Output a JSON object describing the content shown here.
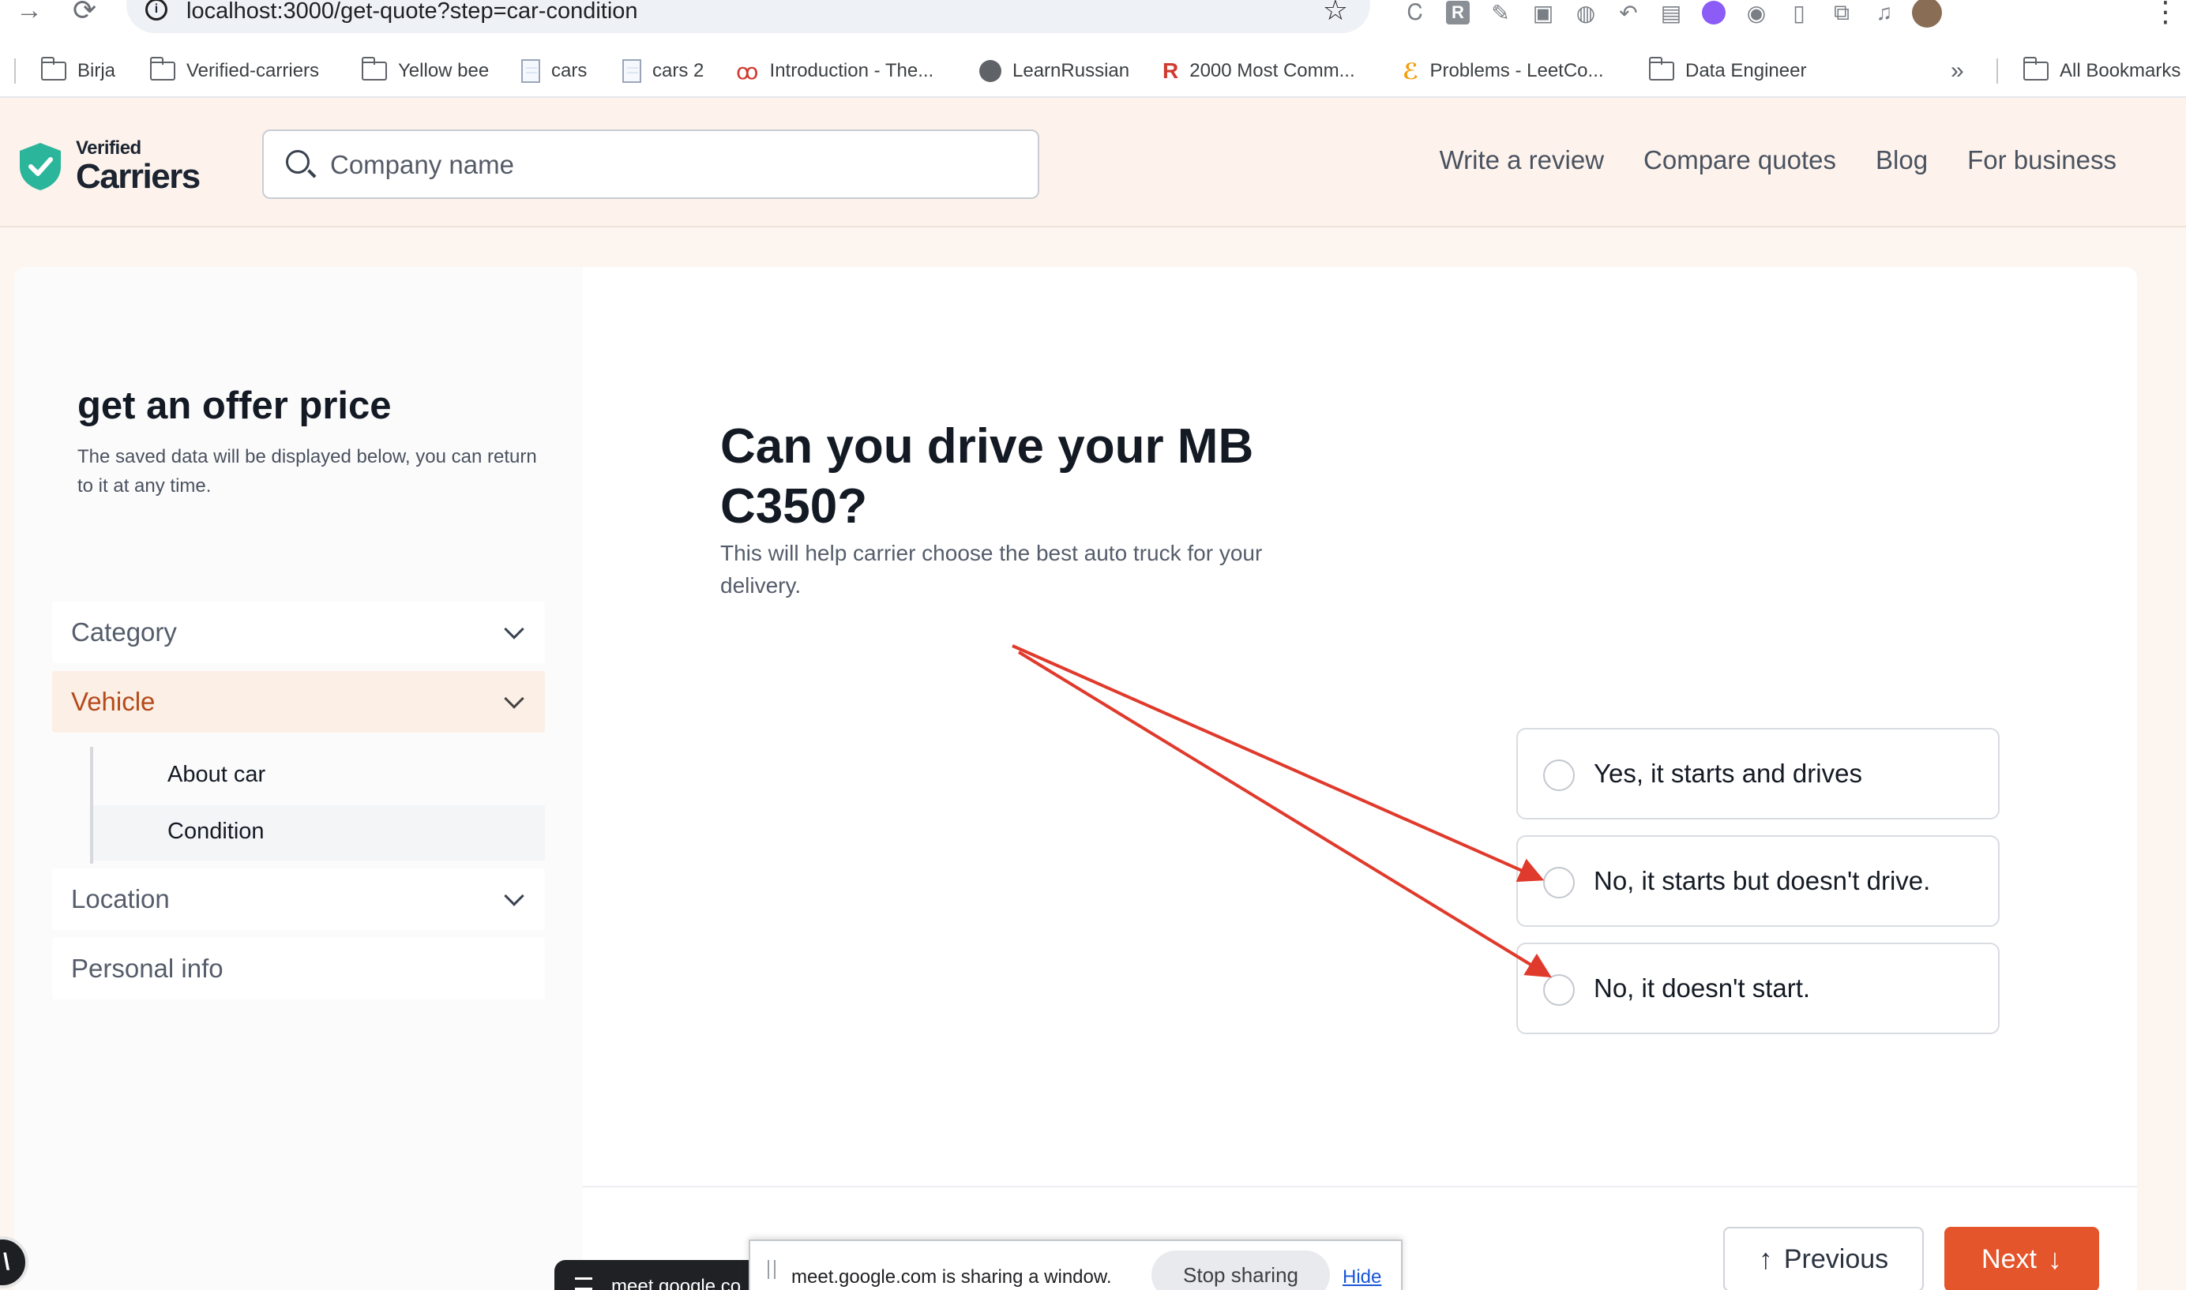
{
  "browser": {
    "url": "localhost:3000/get-quote?step=car-condition",
    "bookmarks": [
      {
        "label": "Birja",
        "icon": "folder-icon"
      },
      {
        "label": "Verified-carriers",
        "icon": "folder-icon"
      },
      {
        "label": "Yellow bee",
        "icon": "folder-icon"
      },
      {
        "label": "cars",
        "icon": "document-icon"
      },
      {
        "label": "cars 2",
        "icon": "document-icon"
      },
      {
        "label": "Introduction - The...",
        "icon": "swirl-icon"
      },
      {
        "label": "LearnRussian",
        "icon": "globe-icon"
      },
      {
        "label": "2000 Most Comm...",
        "icon": "r-logo-icon"
      },
      {
        "label": "Problems - LeetCo...",
        "icon": "leetcode-icon"
      },
      {
        "label": "Data Engineer",
        "icon": "folder-icon"
      }
    ],
    "more_bookmarks_glyph": "»",
    "all_bookmarks": "All Bookmarks",
    "ext_r_letter": "R"
  },
  "header": {
    "logo_small": "Verified",
    "logo_big": "Carriers",
    "search_placeholder": "Company name",
    "nav": [
      "Write a review",
      "Compare quotes",
      "Blog",
      "For business"
    ]
  },
  "sidebar": {
    "title": "get an offer price",
    "subtitle": "The saved data will be displayed below, you can return to it at any time.",
    "steps": [
      {
        "label": "Category"
      },
      {
        "label": "Vehicle"
      },
      {
        "label": "Location"
      },
      {
        "label": "Personal info"
      }
    ],
    "substeps": [
      {
        "label": "About car"
      },
      {
        "label": "Condition"
      }
    ]
  },
  "question": {
    "title": "Can you drive your MB C350?",
    "subtitle": "This will help carrier choose the best auto truck for your delivery.",
    "options": [
      {
        "label": "Yes, it starts and drives"
      },
      {
        "label": "No, it starts but doesn't drive."
      },
      {
        "label": "No, it doesn't start."
      }
    ]
  },
  "footer_buttons": {
    "previous": "Previous",
    "next": "Next"
  },
  "overlays": {
    "meet_tab": "meet.google.co",
    "share_message": "meet.google.com is sharing a window.",
    "stop_sharing": "Stop sharing",
    "hide": "Hide"
  },
  "colors": {
    "accent": "#e4552b",
    "brand_green": "#2bb59a",
    "annotation_arrow": "#e03a2c"
  }
}
